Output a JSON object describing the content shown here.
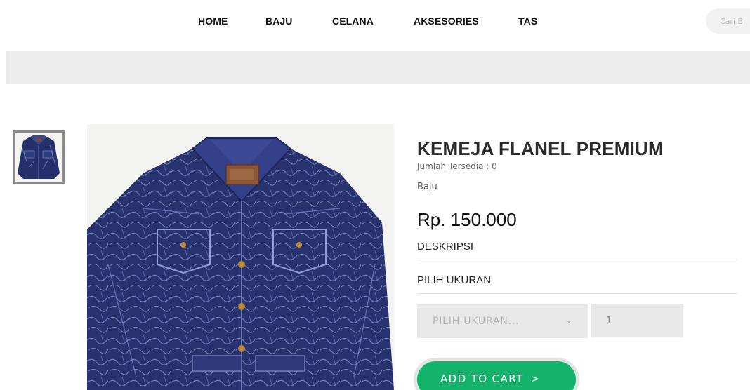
{
  "nav": {
    "items": [
      {
        "label": "HOME"
      },
      {
        "label": "BAJU"
      },
      {
        "label": "CELANA"
      },
      {
        "label": "AKSESORIES"
      },
      {
        "label": "TAS"
      }
    ]
  },
  "search": {
    "placeholder": "Cari B"
  },
  "product": {
    "title": "KEMEJA FLANEL PREMIUM",
    "stock": "Jumlah Tersedia : 0",
    "category": "Baju",
    "price": "Rp. 150.000",
    "description_label": "DESKRIPSI",
    "size_label": "PILIH UKURAN",
    "size_select_value": "PILIH UKURAN...",
    "quantity": "1",
    "add_to_cart_label": "ADD TO CART",
    "add_to_cart_arrow": ">"
  },
  "icons": {
    "chevron": "chevron-down-icon",
    "cart_arrow": "chevron-right-icon"
  },
  "colors": {
    "accent": "#14b36b",
    "banner": "#ececec",
    "field_bg": "#e8e8e8"
  }
}
